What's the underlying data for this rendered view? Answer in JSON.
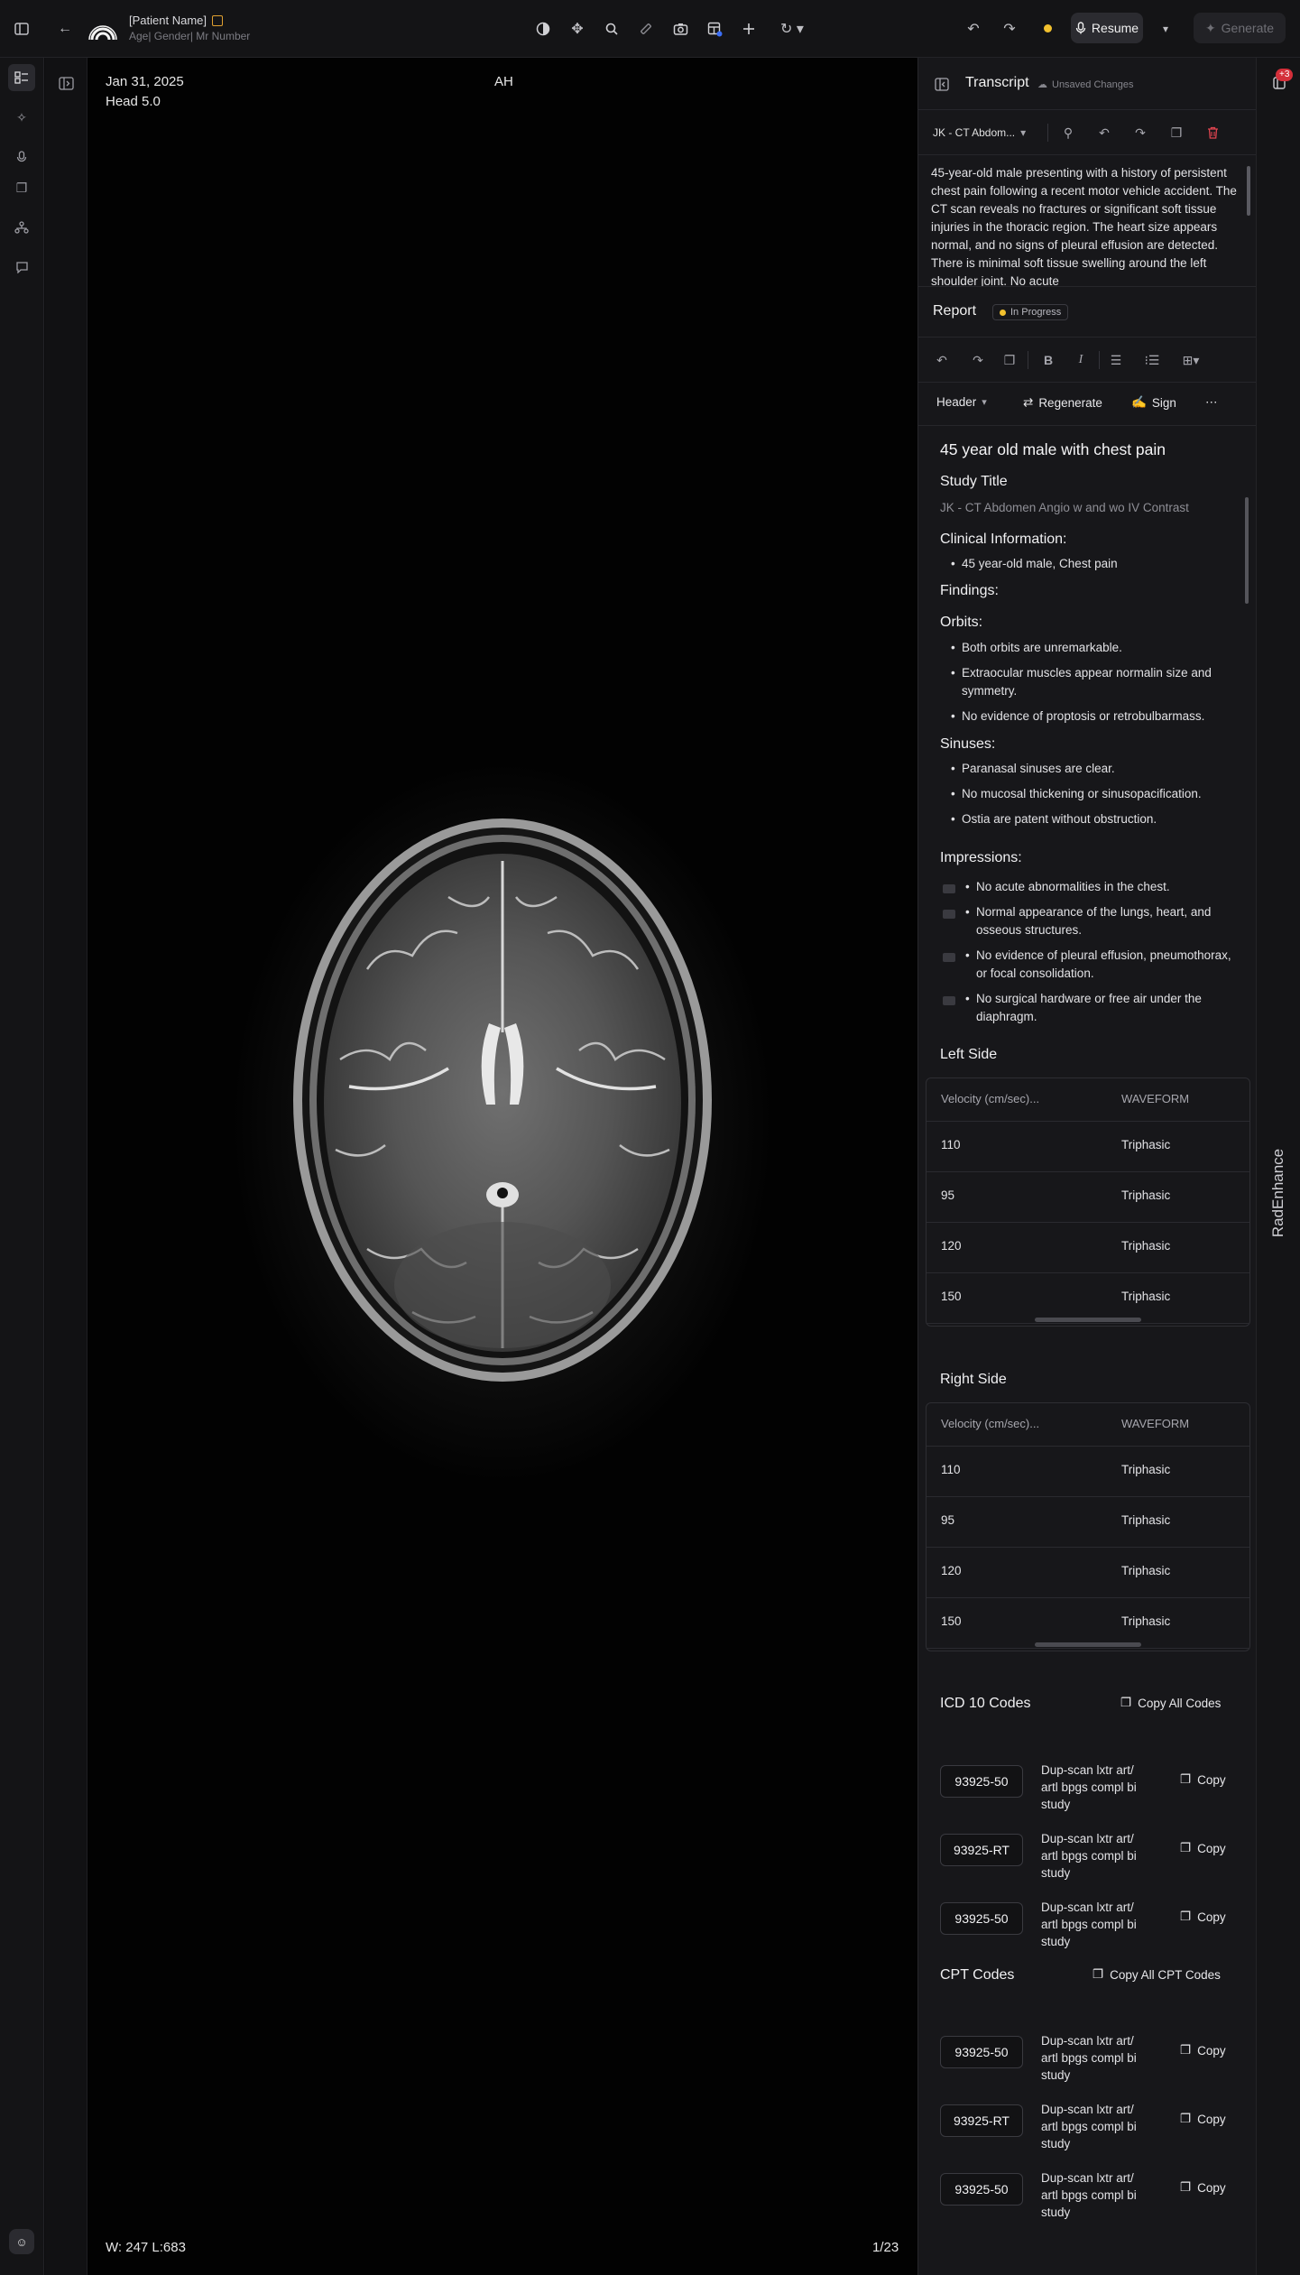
{
  "patient": {
    "name": "[Patient Name]",
    "meta": "Age| Gender| Mr Number"
  },
  "topbar": {
    "resume_label": "Resume",
    "generate_label": "Generate"
  },
  "viewer": {
    "date": "Jan 31, 2025",
    "series": "Head 5.0",
    "orientation": "AH",
    "window_level": "W: 247  L:683",
    "frame": "1/23"
  },
  "transcript": {
    "title": "Transcript",
    "unsaved": "Unsaved Changes",
    "study_select": "JK - CT Abdom...",
    "text": "45-year-old male presenting with a history of persistent chest pain following a recent motor vehicle accident. The CT scan reveals no fractures or significant soft tissue injuries in the thoracic region. The heart size appears normal, and no signs of pleural effusion are detected. There is minimal soft tissue swelling around the left shoulder joint. No acute"
  },
  "report": {
    "title": "Report",
    "status": "In Progress",
    "header_select": "Header",
    "regenerate_label": "Regenerate",
    "sign_label": "Sign",
    "heading": "45 year old male with chest pain",
    "study_title_label": "Study Title",
    "study_title": "JK - CT Abdomen Angio w and wo IV Contrast",
    "clinical_label": "Clinical Information:",
    "clinical_items": [
      "45 year-old male, Chest pain"
    ],
    "findings_label": "Findings:",
    "orbits_label": "Orbits:",
    "orbits_items": [
      "Both orbits are unremarkable.",
      "Extraocular muscles appear normalin size and symmetry.",
      "No evidence of proptosis or retrobulbarmass."
    ],
    "sinuses_label": "Sinuses:",
    "sinuses_items": [
      "Paranasal sinuses are clear.",
      "No mucosal thickening or sinusopacification.",
      "Ostia are patent without obstruction."
    ],
    "impressions_label": "Impressions:",
    "impressions_items": [
      "No acute abnormalities in the chest.",
      "Normal appearance of the lungs, heart, and osseous structures.",
      "No evidence of pleural effusion, pneumothorax, or focal consolidation.",
      "No surgical hardware or free air under the diaphragm."
    ]
  },
  "left_side": {
    "title": "Left Side",
    "col1": "Velocity (cm/sec)...",
    "col2": "WAVEFORM",
    "rows": [
      {
        "velocity": "110",
        "waveform": "Triphasic"
      },
      {
        "velocity": "95",
        "waveform": "Triphasic"
      },
      {
        "velocity": "120",
        "waveform": "Triphasic"
      },
      {
        "velocity": "150",
        "waveform": "Triphasic"
      }
    ]
  },
  "right_side": {
    "title": "Right Side",
    "col1": "Velocity (cm/sec)...",
    "col2": "WAVEFORM",
    "rows": [
      {
        "velocity": "110",
        "waveform": "Triphasic"
      },
      {
        "velocity": "95",
        "waveform": "Triphasic"
      },
      {
        "velocity": "120",
        "waveform": "Triphasic"
      },
      {
        "velocity": "150",
        "waveform": "Triphasic"
      }
    ]
  },
  "icd10": {
    "title": "ICD 10 Codes",
    "copy_all": "Copy All Codes",
    "copy_label": "Copy",
    "codes": [
      {
        "code": "93925-50",
        "desc": "Dup-scan lxtr art/ artl bpgs compl bi study"
      },
      {
        "code": "93925-RT",
        "desc": "Dup-scan lxtr art/ artl bpgs compl bi study"
      },
      {
        "code": "93925-50",
        "desc": "Dup-scan lxtr art/ artl bpgs compl bi study"
      }
    ]
  },
  "cpt": {
    "title": "CPT Codes",
    "copy_all": "Copy All CPT Codes",
    "copy_label": "Copy",
    "codes": [
      {
        "code": "93925-50",
        "desc": "Dup-scan lxtr art/ artl bpgs compl bi study"
      },
      {
        "code": "93925-RT",
        "desc": "Dup-scan lxtr art/ artl bpgs compl bi study"
      },
      {
        "code": "93925-50",
        "desc": "Dup-scan lxtr art/ artl bpgs compl bi study"
      }
    ]
  },
  "side_strip": {
    "badge": "+3",
    "label": "RadEnhance"
  },
  "colors": {
    "accent_yellow": "#f2c12e",
    "badge_red": "#d42f3a",
    "danger": "#e0444f"
  }
}
